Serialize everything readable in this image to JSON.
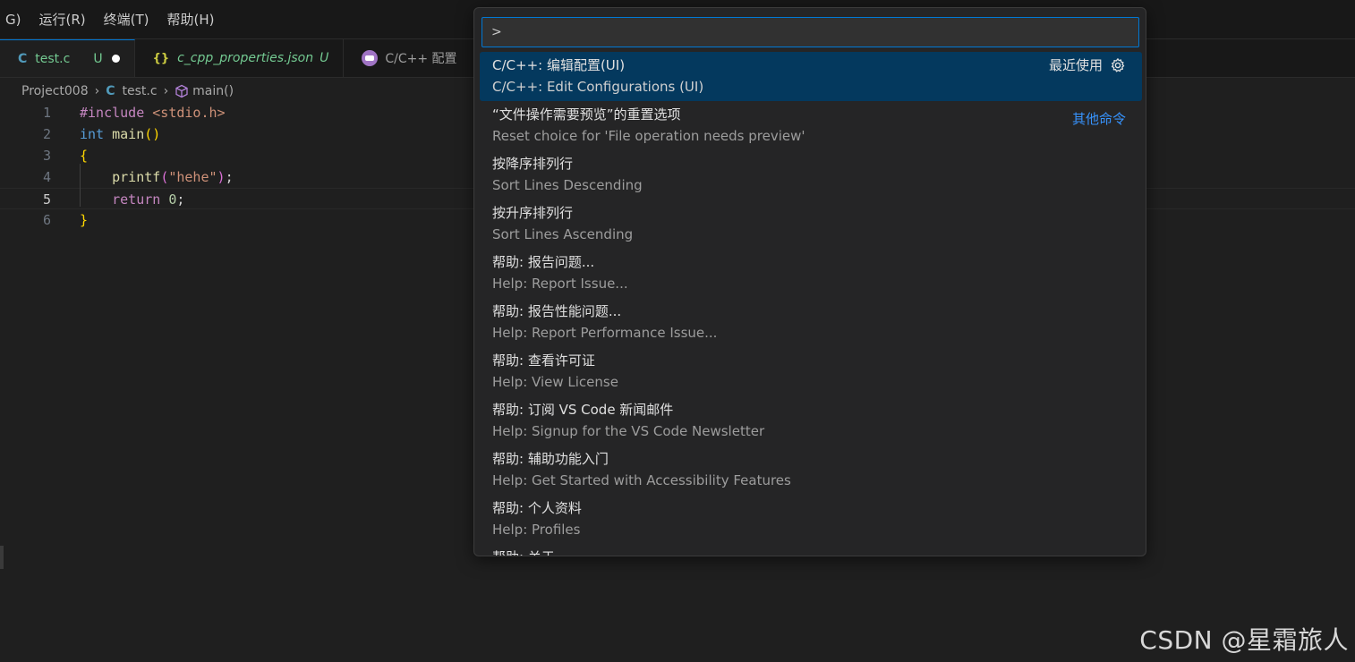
{
  "menubar": {
    "items": [
      "G)",
      "运行(R)",
      "终端(T)",
      "帮助(H)"
    ]
  },
  "tabs": [
    {
      "icon": "C",
      "label": "test.c",
      "status": "U"
    },
    {
      "icon": "{}",
      "label": "c_cpp_properties.json",
      "status": "U"
    },
    {
      "label": "C/C++ 配置"
    }
  ],
  "breadcrumb": {
    "folder": "Project008",
    "file_icon": "C",
    "file": "test.c",
    "symbol": "main()"
  },
  "editor": {
    "line_numbers": [
      "1",
      "2",
      "3",
      "4",
      "5",
      "6"
    ],
    "line1": {
      "pre": "#include",
      "header": "<stdio.h>"
    },
    "line2": {
      "type": "int",
      "fn": "main",
      "parens": "()"
    },
    "line3": {
      "brace": "{"
    },
    "line4": {
      "indent": "    ",
      "fn": "printf",
      "open": "(",
      "str": "\"hehe\"",
      "close": ")",
      "semi": ";"
    },
    "line5": {
      "indent": "    ",
      "kw": "return",
      "num": "0",
      "semi": ";"
    },
    "line6": {
      "brace": "}"
    }
  },
  "palette": {
    "input_value": ">",
    "commands": [
      {
        "label": "C/C++: 编辑配置(UI)",
        "sub": "C/C++: Edit Configurations (UI)",
        "meta": "最近使用"
      },
      {
        "label": "“文件操作需要预览”的重置选项",
        "sub": "Reset choice for 'File operation needs preview'",
        "meta": "其他命令"
      },
      {
        "label": "按降序排列行",
        "sub": "Sort Lines Descending"
      },
      {
        "label": "按升序排列行",
        "sub": "Sort Lines Ascending"
      },
      {
        "label": "帮助: 报告问题...",
        "sub": "Help: Report Issue..."
      },
      {
        "label": "帮助: 报告性能问题...",
        "sub": "Help: Report Performance Issue..."
      },
      {
        "label": "帮助: 查看许可证",
        "sub": "Help: View License"
      },
      {
        "label": "帮助: 订阅 VS Code 新闻邮件",
        "sub": "Help: Signup for the VS Code Newsletter"
      },
      {
        "label": "帮助: 辅助功能入门",
        "sub": "Help: Get Started with Accessibility Features"
      },
      {
        "label": "帮助: 个人资料",
        "sub": "Help: Profiles"
      },
      {
        "label": "帮助: 关于"
      }
    ]
  },
  "watermark": "CSDN @星霜旅人",
  "colors": {
    "accent": "#0078d4",
    "selection": "#04395e",
    "link": "#3794ff",
    "git_untracked": "#73c991"
  }
}
